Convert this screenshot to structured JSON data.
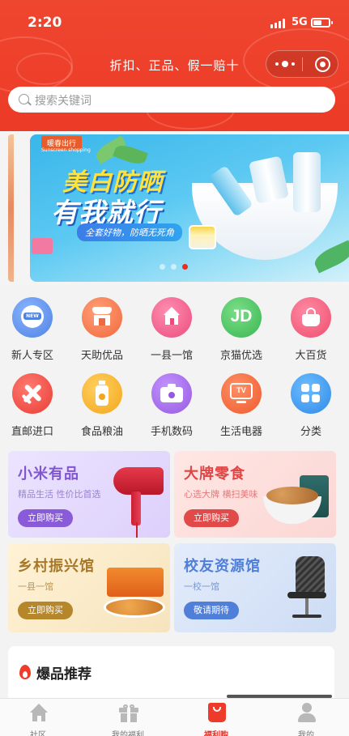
{
  "status_bar": {
    "time": "2:20",
    "network": "5G"
  },
  "header": {
    "slogan": "折扣、正品、假一赔十",
    "more_icon": "more-dots-icon",
    "target_icon": "target-circle-icon"
  },
  "search": {
    "placeholder": "搜索关键词"
  },
  "banner": {
    "tag": "暖春出行",
    "tag_sub": "Sunscreen shopping",
    "title_line1": "美白防晒",
    "title_line2": "有我就行",
    "subtitle": "全套好物，防晒无死角",
    "slide_count": 3,
    "active_slide": 3
  },
  "categories": [
    {
      "label": "新人专区",
      "icon": "new-badge-icon",
      "color": "#5b8fe8"
    },
    {
      "label": "天助优品",
      "icon": "shop-icon",
      "color": "#f47a4a"
    },
    {
      "label": "一县一馆",
      "icon": "house-icon",
      "color": "#ef5f8f"
    },
    {
      "label": "京猫优选",
      "icon": "jd-logo-icon",
      "color": "#49c05c"
    },
    {
      "label": "大百货",
      "icon": "shopping-bag-icon",
      "color": "#f25c7c"
    },
    {
      "label": "直邮进口",
      "icon": "airplane-icon",
      "color": "#ef4a3e"
    },
    {
      "label": "食品粮油",
      "icon": "oil-bottle-icon",
      "color": "#f6b128"
    },
    {
      "label": "手机数码",
      "icon": "camera-icon",
      "color": "#a468e6"
    },
    {
      "label": "生活电器",
      "icon": "tv-icon",
      "color": "#f3663a"
    },
    {
      "label": "分类",
      "icon": "grid-icon",
      "color": "#3e9bef"
    }
  ],
  "promos": [
    {
      "title": "小米有品",
      "subtitle": "精品生活 性价比首选",
      "button": "立即购买",
      "accent": "#8a5bd8"
    },
    {
      "title": "大牌零食",
      "subtitle": "心选大牌 横扫美味",
      "button": "立即购买",
      "accent": "#e24a4a"
    },
    {
      "title": "乡村振兴馆",
      "subtitle": "一县一馆",
      "button": "立即购买",
      "accent": "#b6862a"
    },
    {
      "title": "校友资源馆",
      "subtitle": "一校一馆",
      "button": "敬请期待",
      "accent": "#4f7fd8"
    }
  ],
  "hot": {
    "title": "爆品推荐"
  },
  "tabs": [
    {
      "label": "社区",
      "icon": "home-icon",
      "active": false
    },
    {
      "label": "我的福利",
      "icon": "gift-icon",
      "active": false
    },
    {
      "label": "福利购",
      "icon": "shopping-bag-icon",
      "active": true
    },
    {
      "label": "我的",
      "icon": "user-icon",
      "active": false
    }
  ],
  "colors": {
    "brand_red": "#ee3e28",
    "tab_active": "#e8322a"
  }
}
